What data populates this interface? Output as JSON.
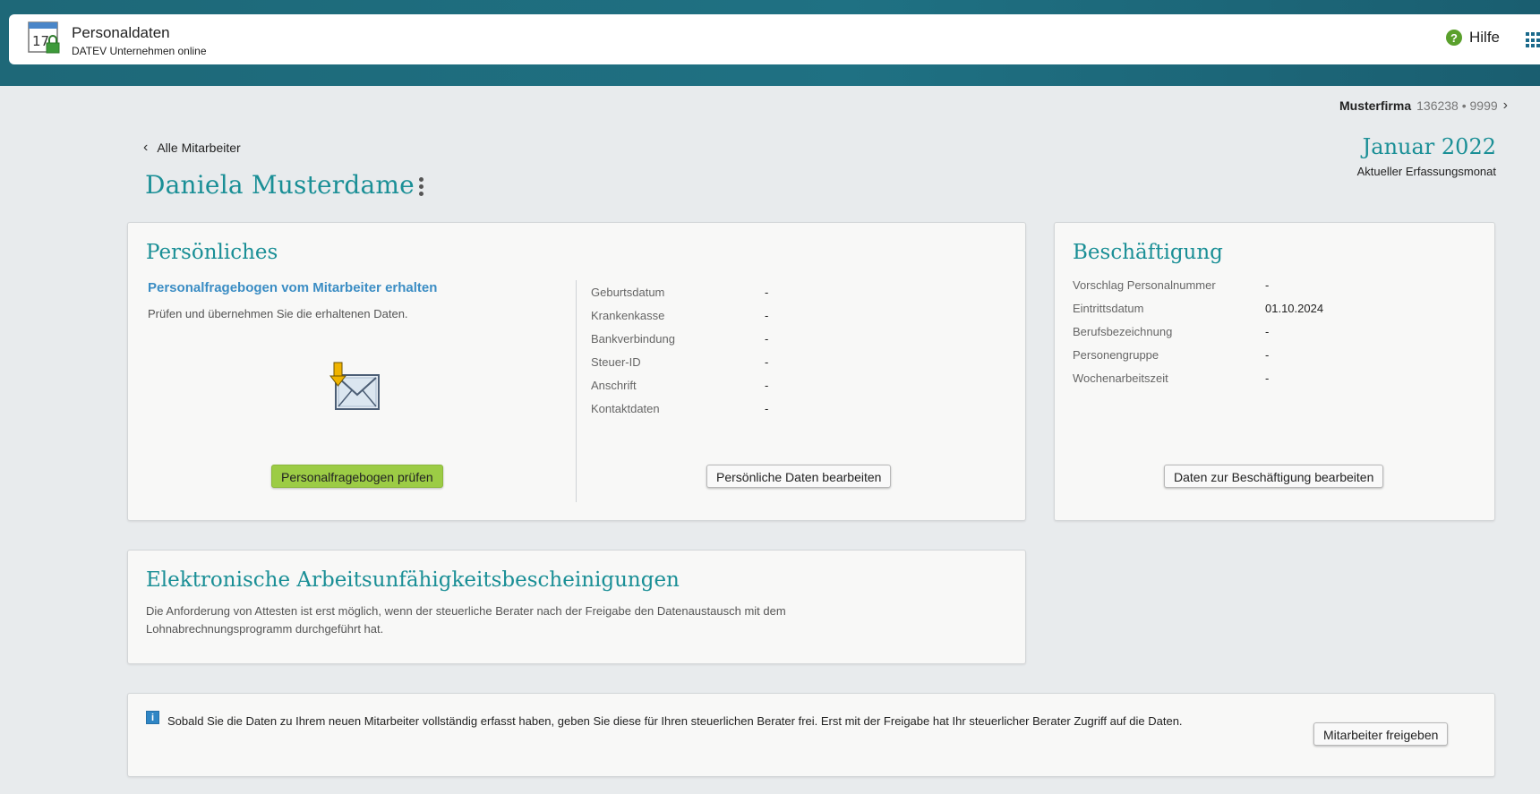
{
  "app": {
    "icon_name": "calendar-lock-icon",
    "icon_day": "17",
    "title": "Personaldaten",
    "subtitle": "DATEV Unternehmen online"
  },
  "header": {
    "help_icon": "help-circle-icon",
    "help_label": "Hilfe",
    "apps_icon": "app-grid-icon"
  },
  "company": {
    "name": "Musterfirma",
    "number": "136238 • 9999",
    "chevron_icon": "chevron-right-icon"
  },
  "nav": {
    "back_label": "Alle Mitarbeiter",
    "back_icon": "chevron-left-icon"
  },
  "employee": {
    "name": "Daniela Musterdame",
    "menu_icon": "kebab-menu-icon"
  },
  "period": {
    "month": "Januar 2022",
    "label": "Aktueller Erfassungsmonat"
  },
  "personal": {
    "title": "Persönliches",
    "questionnaire_title": "Personalfragebogen vom Mitarbeiter erhalten",
    "questionnaire_text": "Prüfen und übernehmen Sie die erhaltenen Daten.",
    "questionnaire_icon": "mail-download-icon",
    "check_button": "Personalfragebogen prüfen",
    "fields": [
      {
        "label": "Geburtsdatum",
        "value": "-"
      },
      {
        "label": "Krankenkasse",
        "value": "-"
      },
      {
        "label": "Bankverbindung",
        "value": "-"
      },
      {
        "label": "Steuer-ID",
        "value": "-"
      },
      {
        "label": "Anschrift",
        "value": "-"
      },
      {
        "label": "Kontaktdaten",
        "value": "-"
      }
    ],
    "edit_button": "Persönliche Daten bearbeiten"
  },
  "employment": {
    "title": "Beschäftigung",
    "fields": [
      {
        "label": "Vorschlag Personalnummer",
        "value": "-"
      },
      {
        "label": "Eintrittsdatum",
        "value": "01.10.2024"
      },
      {
        "label": "Berufsbezeichnung",
        "value": "-"
      },
      {
        "label": "Personengruppe",
        "value": "-"
      },
      {
        "label": "Wochenarbeitszeit",
        "value": "-"
      }
    ],
    "edit_button": "Daten zur Beschäftigung bearbeiten"
  },
  "eau": {
    "title": "Elektronische Arbeitsunfähigkeitsbescheinigungen",
    "text": "Die Anforderung von Attesten ist erst möglich, wenn der steuerliche Berater nach der Freigabe den Datenaustausch mit dem Lohnabrechnungsprogramm durchgeführt hat."
  },
  "release": {
    "info_icon": "info-icon",
    "text": "Sobald Sie die Daten zu Ihrem neuen Mitarbeiter vollständig erfasst haben, geben Sie diese für Ihren steuerlichen Berater frei. Erst mit der Freigabe hat Ihr steuerlicher Berater Zugriff auf die Daten.",
    "button": "Mitarbeiter freigeben"
  },
  "colors": {
    "accent_teal": "#1a8f96",
    "link_blue": "#3b8dc4",
    "header_band": "#1f7183",
    "primary_button": "#9ccc45"
  }
}
